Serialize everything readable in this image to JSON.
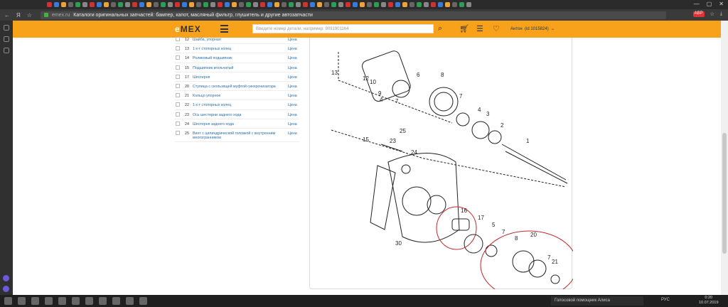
{
  "browser": {
    "url_domain": "emex.ru",
    "page_title": "Каталоги оригинальных запчастей: бампер, капот, масляный фильтр, глушитель и другие автозапчасти",
    "ext_badge": "ABP"
  },
  "header": {
    "logo_e": "e",
    "logo_rest": "MEX",
    "search_placeholder": "Введите номер детали, например: 9091901164",
    "user_name": "Антон",
    "user_id": "(id 1015824)"
  },
  "parts": [
    {
      "num": "12",
      "name": "Шайба, упорная",
      "price": "Цена"
    },
    {
      "num": "13",
      "name": "1 к-т стопорных колец",
      "price": "Цена"
    },
    {
      "num": "14",
      "name": "Роликовый подшипник",
      "price": "Цена"
    },
    {
      "num": "15",
      "name": "Подшипник игольчатый",
      "price": "Цена"
    },
    {
      "num": "17",
      "name": "Шестерня",
      "price": "Цена"
    },
    {
      "num": "20",
      "name": "Ступица с скользящей муфтой синхронизатора",
      "price": "Цена"
    },
    {
      "num": "21",
      "name": "Кольцо упорное",
      "price": "Цена"
    },
    {
      "num": "22",
      "name": "1 к-т стопорных колец",
      "price": "Цена"
    },
    {
      "num": "23",
      "name": "Ось шестерни заднего хода",
      "price": "Цена"
    },
    {
      "num": "24",
      "name": "Шестерня заднего хода",
      "price": "Цена"
    },
    {
      "num": "25",
      "name": "Винт с цилиндрической головкой с внутренним многогранником",
      "price": "Цена"
    }
  ],
  "diagram_labels": [
    "13",
    "12",
    "10",
    "9",
    "4",
    "7",
    "6",
    "8",
    "7",
    "4",
    "3",
    "2",
    "1",
    "15",
    "23",
    "25",
    "24",
    "16",
    "17",
    "5",
    "7",
    "8",
    "20",
    "7",
    "21",
    "22",
    "30"
  ],
  "taskbar": {
    "alice": "Голосовой помощник Алиса",
    "lang": "РУС",
    "time": "0:20",
    "date": "10.07.2019"
  }
}
